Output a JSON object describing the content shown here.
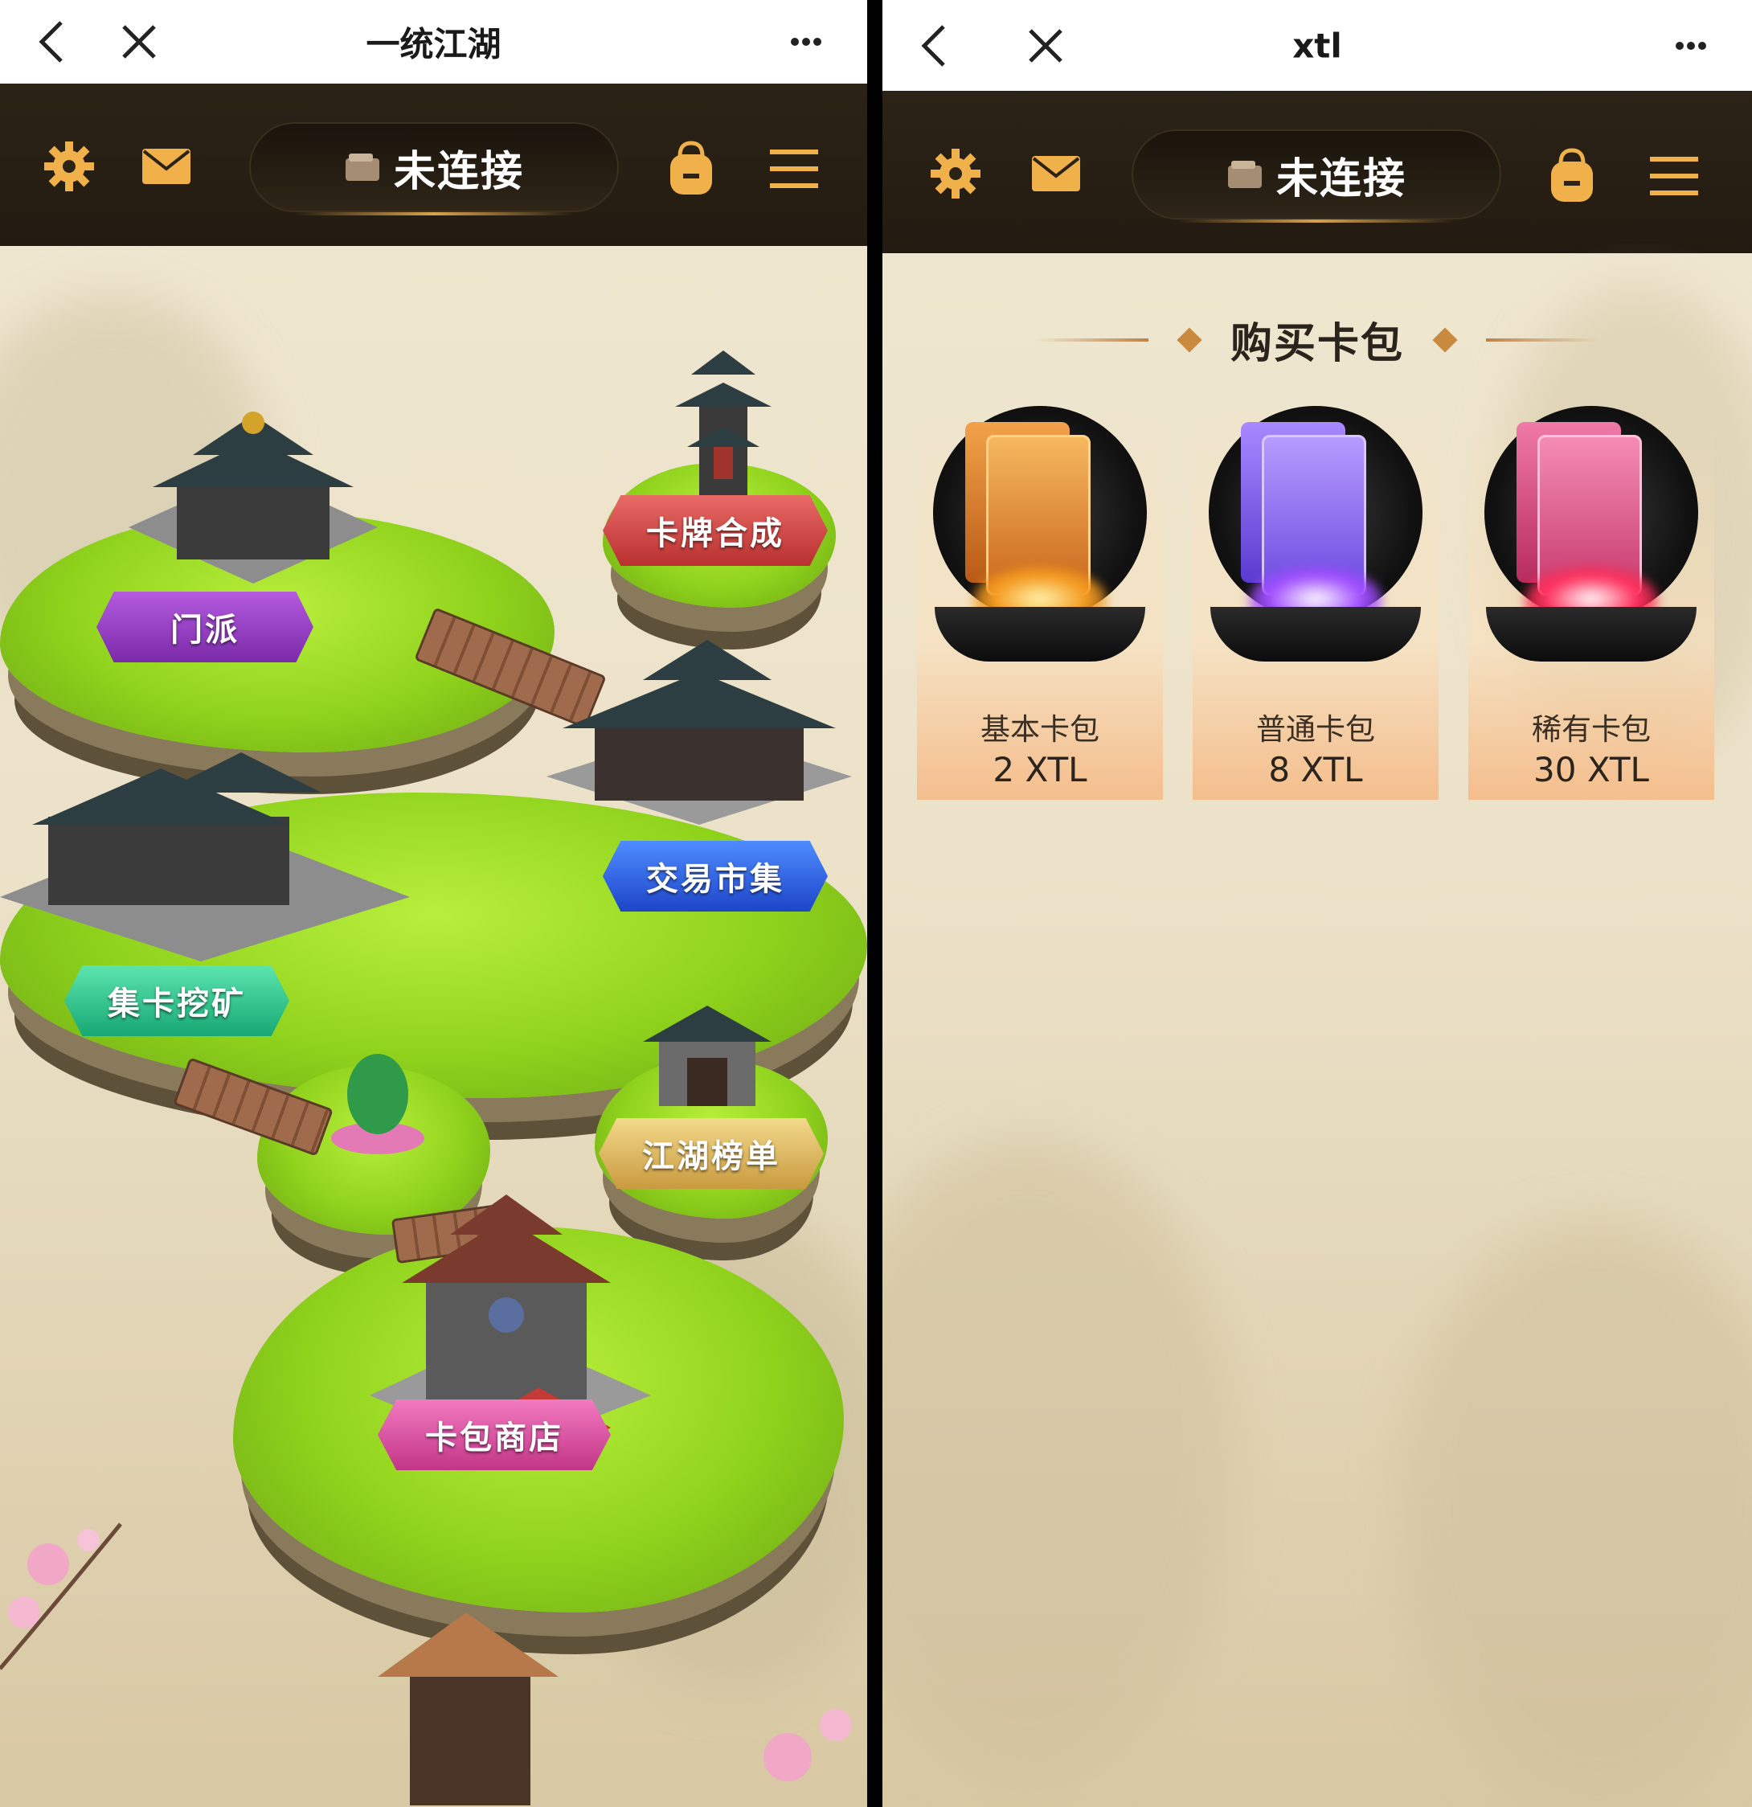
{
  "left": {
    "window_title": "一统江湖",
    "connection_status": "未连接",
    "map_locations": [
      {
        "label": "门派"
      },
      {
        "label": "卡牌合成"
      },
      {
        "label": "交易市集"
      },
      {
        "label": "集卡挖矿"
      },
      {
        "label": "江湖榜单"
      },
      {
        "label": "卡包商店"
      }
    ]
  },
  "right": {
    "window_title": "xtl",
    "connection_status": "未连接",
    "shop_title": "购买卡包",
    "packs": [
      {
        "name": "基本卡包",
        "price": "2 XTL",
        "color": "#e08a2b"
      },
      {
        "name": "普通卡包",
        "price": "8 XTL",
        "color": "#8a5cf0"
      },
      {
        "name": "稀有卡包",
        "price": "30 XTL",
        "color": "#e0457a"
      }
    ]
  },
  "icons": [
    "back-icon",
    "close-icon",
    "more-icon",
    "gear-icon",
    "mail-icon",
    "wallet-icon",
    "backpack-icon",
    "menu-icon"
  ],
  "colors": {
    "header_bg": "#2c2317",
    "accent_gold": "#d9a34c",
    "page_bg": "#efe6cf"
  }
}
